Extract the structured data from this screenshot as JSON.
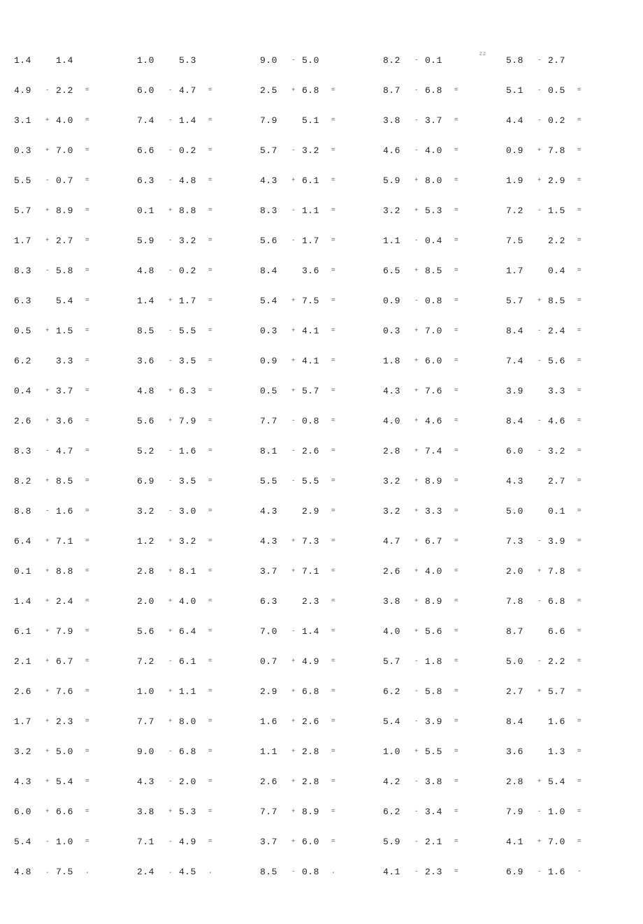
{
  "rows": [
    [
      {
        "a": "1.4",
        "op": "",
        "b": "1.4",
        "eq": ""
      },
      {
        "a": "1.0",
        "op": "",
        "b": "5.3",
        "eq": ""
      },
      {
        "a": "9.0",
        "op": "-",
        "b": "5.0",
        "eq": ""
      },
      {
        "a": "8.2",
        "op": "-",
        "b": "0.1",
        "eq": "",
        "sup": "zz"
      },
      {
        "a": "5.8",
        "op": "-",
        "b": "2.7",
        "eq": ""
      }
    ],
    [
      {
        "a": "4.9",
        "op": "-",
        "b": "2.2",
        "eq": "="
      },
      {
        "a": "6.0",
        "op": "-",
        "b": "4.7",
        "eq": "="
      },
      {
        "a": "2.5",
        "op": "+",
        "b": "6.8",
        "eq": "="
      },
      {
        "a": "8.7",
        "op": "-",
        "b": "6.8",
        "eq": "="
      },
      {
        "a": "5.1",
        "op": "-",
        "b": "0.5",
        "eq": "="
      }
    ],
    [
      {
        "a": "3.1",
        "op": "+",
        "b": "4.0",
        "eq": "="
      },
      {
        "a": "7.4",
        "op": "-",
        "b": "1.4",
        "eq": "="
      },
      {
        "a": "7.9",
        "op": "",
        "b": "5.1",
        "eq": "="
      },
      {
        "a": "3.8",
        "op": "-",
        "b": "3.7",
        "eq": "="
      },
      {
        "a": "4.4",
        "op": "-",
        "b": "0.2",
        "eq": "="
      }
    ],
    [
      {
        "a": "0.3",
        "op": "+",
        "b": "7.0",
        "eq": "="
      },
      {
        "a": "6.6",
        "op": "-",
        "b": "0.2",
        "eq": "="
      },
      {
        "a": "5.7",
        "op": "-",
        "b": "3.2",
        "eq": "="
      },
      {
        "a": "4.6",
        "op": "-",
        "b": "4.0",
        "eq": "="
      },
      {
        "a": "0.9",
        "op": "+",
        "b": "7.8",
        "eq": "="
      }
    ],
    [
      {
        "a": "5.5",
        "op": "-",
        "b": "0.7",
        "eq": "="
      },
      {
        "a": "6.3",
        "op": "-",
        "b": "4.8",
        "eq": "="
      },
      {
        "a": "4.3",
        "op": "+",
        "b": "6.1",
        "eq": "="
      },
      {
        "a": "5.9",
        "op": "+",
        "b": "8.0",
        "eq": "="
      },
      {
        "a": "1.9",
        "op": "+",
        "b": "2.9",
        "eq": "="
      }
    ],
    [
      {
        "a": "5.7",
        "op": "+",
        "b": "8.9",
        "eq": "="
      },
      {
        "a": "0.1",
        "op": "+",
        "b": "8.8",
        "eq": "="
      },
      {
        "a": "8.3",
        "op": "-",
        "b": "1.1",
        "eq": "="
      },
      {
        "a": "3.2",
        "op": "+",
        "b": "5.3",
        "eq": "="
      },
      {
        "a": "7.2",
        "op": "-",
        "b": "1.5",
        "eq": "="
      }
    ],
    [
      {
        "a": "1.7",
        "op": "+",
        "b": "2.7",
        "eq": "="
      },
      {
        "a": "5.9",
        "op": "-",
        "b": "3.2",
        "eq": "="
      },
      {
        "a": "5.6",
        "op": "-",
        "b": "1.7",
        "eq": "="
      },
      {
        "a": "1.1",
        "op": "-",
        "b": "0.4",
        "eq": "="
      },
      {
        "a": "7.5",
        "op": "",
        "b": "2.2",
        "eq": "="
      }
    ],
    [
      {
        "a": "8.3",
        "op": "-",
        "b": "5.8",
        "eq": "="
      },
      {
        "a": "4.8",
        "op": "-",
        "b": "0.2",
        "eq": "="
      },
      {
        "a": "8.4",
        "op": "",
        "b": "3.6",
        "eq": "="
      },
      {
        "a": "6.5",
        "op": "+",
        "b": "8.5",
        "eq": "="
      },
      {
        "a": "1.7",
        "op": "",
        "b": "0.4",
        "eq": "="
      }
    ],
    [
      {
        "a": "6.3",
        "op": "",
        "b": "5.4",
        "eq": "="
      },
      {
        "a": "1.4",
        "op": "+",
        "b": "1.7",
        "eq": "="
      },
      {
        "a": "5.4",
        "op": "+",
        "b": "7.5",
        "eq": "="
      },
      {
        "a": "0.9",
        "op": "-",
        "b": "0.8",
        "eq": "="
      },
      {
        "a": "5.7",
        "op": "+",
        "b": "8.5",
        "eq": "="
      }
    ],
    [
      {
        "a": "0.5",
        "op": "+",
        "b": "1.5",
        "eq": "="
      },
      {
        "a": "8.5",
        "op": "-",
        "b": "5.5",
        "eq": "="
      },
      {
        "a": "0.3",
        "op": "+",
        "b": "4.1",
        "eq": "="
      },
      {
        "a": "0.3",
        "op": "+",
        "b": "7.0",
        "eq": "="
      },
      {
        "a": "8.4",
        "op": "-",
        "b": "2.4",
        "eq": "="
      }
    ],
    [
      {
        "a": "6.2",
        "op": "",
        "b": "3.3",
        "eq": "="
      },
      {
        "a": "3.6",
        "op": "-",
        "b": "3.5",
        "eq": "="
      },
      {
        "a": "0.9",
        "op": "+",
        "b": "4.1",
        "eq": "="
      },
      {
        "a": "1.8",
        "op": "+",
        "b": "6.0",
        "eq": "="
      },
      {
        "a": "7.4",
        "op": "-",
        "b": "5.6",
        "eq": "="
      }
    ],
    [
      {
        "a": "0.4",
        "op": "+",
        "b": "3.7",
        "eq": "="
      },
      {
        "a": "4.8",
        "op": "+",
        "b": "6.3",
        "eq": "="
      },
      {
        "a": "0.5",
        "op": "+",
        "b": "5.7",
        "eq": "="
      },
      {
        "a": "4.3",
        "op": "+",
        "b": "7.6",
        "eq": "="
      },
      {
        "a": "3.9",
        "op": "",
        "b": "3.3",
        "eq": "="
      }
    ],
    [
      {
        "a": "2.6",
        "op": "+",
        "b": "3.6",
        "eq": "="
      },
      {
        "a": "5.6",
        "op": "+",
        "b": "7.9",
        "eq": "="
      },
      {
        "a": "7.7",
        "op": "-",
        "b": "0.8",
        "eq": "="
      },
      {
        "a": "4.0",
        "op": "+",
        "b": "4.6",
        "eq": "="
      },
      {
        "a": "8.4",
        "op": "-",
        "b": "4.6",
        "eq": "="
      }
    ],
    [
      {
        "a": "8.3",
        "op": "-",
        "b": "4.7",
        "eq": "="
      },
      {
        "a": "5.2",
        "op": "-",
        "b": "1.6",
        "eq": "="
      },
      {
        "a": "8.1",
        "op": "-",
        "b": "2.6",
        "eq": "="
      },
      {
        "a": "2.8",
        "op": "+",
        "b": "7.4",
        "eq": "="
      },
      {
        "a": "6.0",
        "op": "-",
        "b": "3.2",
        "eq": "="
      }
    ],
    [
      {
        "a": "8.2",
        "op": "+",
        "b": "8.5",
        "eq": "="
      },
      {
        "a": "6.9",
        "op": "-",
        "b": "3.5",
        "eq": "="
      },
      {
        "a": "5.5",
        "op": "-",
        "b": "5.5",
        "eq": "="
      },
      {
        "a": "3.2",
        "op": "+",
        "b": "8.9",
        "eq": "="
      },
      {
        "a": "4.3",
        "op": "",
        "b": "2.7",
        "eq": "="
      }
    ],
    [
      {
        "a": "8.8",
        "op": "-",
        "b": "1.6",
        "eq": "="
      },
      {
        "a": "3.2",
        "op": "-",
        "b": "3.0",
        "eq": "="
      },
      {
        "a": "4.3",
        "op": "",
        "b": "2.9",
        "eq": "="
      },
      {
        "a": "3.2",
        "op": "+",
        "b": "3.3",
        "eq": "="
      },
      {
        "a": "5.0",
        "op": "",
        "b": "0.1",
        "eq": "="
      }
    ],
    [
      {
        "a": "6.4",
        "op": "+",
        "b": "7.1",
        "eq": "="
      },
      {
        "a": "1.2",
        "op": "+",
        "b": "3.2",
        "eq": "="
      },
      {
        "a": "4.3",
        "op": "+",
        "b": "7.3",
        "eq": "="
      },
      {
        "a": "4.7",
        "op": "+",
        "b": "6.7",
        "eq": "="
      },
      {
        "a": "7.3",
        "op": "-",
        "b": "3.9",
        "eq": "="
      }
    ],
    [
      {
        "a": "0.1",
        "op": "+",
        "b": "8.8",
        "eq": "="
      },
      {
        "a": "2.8",
        "op": "+",
        "b": "8.1",
        "eq": "="
      },
      {
        "a": "3.7",
        "op": "+",
        "b": "7.1",
        "eq": "="
      },
      {
        "a": "2.6",
        "op": "+",
        "b": "4.0",
        "eq": "="
      },
      {
        "a": "2.0",
        "op": "+",
        "b": "7.8",
        "eq": "="
      }
    ],
    [
      {
        "a": "1.4",
        "op": "+",
        "b": "2.4",
        "eq": "="
      },
      {
        "a": "2.0",
        "op": "+",
        "b": "4.0",
        "eq": "="
      },
      {
        "a": "6.3",
        "op": "",
        "b": "2.3",
        "eq": "="
      },
      {
        "a": "3.8",
        "op": "+",
        "b": "8.9",
        "eq": "="
      },
      {
        "a": "7.8",
        "op": "-",
        "b": "6.8",
        "eq": "="
      }
    ],
    [
      {
        "a": "6.1",
        "op": "+",
        "b": "7.9",
        "eq": "="
      },
      {
        "a": "5.6",
        "op": "+",
        "b": "6.4",
        "eq": "="
      },
      {
        "a": "7.0",
        "op": "-",
        "b": "1.4",
        "eq": "="
      },
      {
        "a": "4.0",
        "op": "+",
        "b": "5.6",
        "eq": "="
      },
      {
        "a": "8.7",
        "op": "",
        "b": "6.6",
        "eq": "="
      }
    ],
    [
      {
        "a": "2.1",
        "op": "+",
        "b": "6.7",
        "eq": "="
      },
      {
        "a": "7.2",
        "op": "-",
        "b": "6.1",
        "eq": "="
      },
      {
        "a": "0.7",
        "op": "+",
        "b": "4.9",
        "eq": "="
      },
      {
        "a": "5.7",
        "op": "-",
        "b": "1.8",
        "eq": "="
      },
      {
        "a": "5.0",
        "op": "-",
        "b": "2.2",
        "eq": "="
      }
    ],
    [
      {
        "a": "2.6",
        "op": "+",
        "b": "7.6",
        "eq": "="
      },
      {
        "a": "1.0",
        "op": "+",
        "b": "1.1",
        "eq": "="
      },
      {
        "a": "2.9",
        "op": "+",
        "b": "6.8",
        "eq": "="
      },
      {
        "a": "6.2",
        "op": "-",
        "b": "5.8",
        "eq": "="
      },
      {
        "a": "2.7",
        "op": "+",
        "b": "5.7",
        "eq": "="
      }
    ],
    [
      {
        "a": "1.7",
        "op": "+",
        "b": "2.3",
        "eq": "="
      },
      {
        "a": "7.7",
        "op": "+",
        "b": "8.0",
        "eq": "="
      },
      {
        "a": "1.6",
        "op": "+",
        "b": "2.6",
        "eq": "="
      },
      {
        "a": "5.4",
        "op": "-",
        "b": "3.9",
        "eq": "="
      },
      {
        "a": "8.4",
        "op": "",
        "b": "1.6",
        "eq": "="
      }
    ],
    [
      {
        "a": "3.2",
        "op": "+",
        "b": "5.0",
        "eq": "="
      },
      {
        "a": "9.0",
        "op": "-",
        "b": "6.8",
        "eq": "="
      },
      {
        "a": "1.1",
        "op": "+",
        "b": "2.8",
        "eq": "="
      },
      {
        "a": "1.0",
        "op": "+",
        "b": "5.5",
        "eq": "="
      },
      {
        "a": "3.6",
        "op": "",
        "b": "1.3",
        "eq": "="
      }
    ],
    [
      {
        "a": "4.3",
        "op": "+",
        "b": "5.4",
        "eq": "="
      },
      {
        "a": "4.3",
        "op": "-",
        "b": "2.0",
        "eq": "="
      },
      {
        "a": "2.6",
        "op": "+",
        "b": "2.8",
        "eq": "="
      },
      {
        "a": "4.2",
        "op": "-",
        "b": "3.8",
        "eq": "="
      },
      {
        "a": "2.8",
        "op": "+",
        "b": "5.4",
        "eq": "="
      }
    ],
    [
      {
        "a": "6.0",
        "op": "+",
        "b": "6.6",
        "eq": "="
      },
      {
        "a": "3.8",
        "op": "+",
        "b": "5.3",
        "eq": "="
      },
      {
        "a": "7.7",
        "op": "+",
        "b": "8.9",
        "eq": "="
      },
      {
        "a": "6.2",
        "op": "-",
        "b": "3.4",
        "eq": "="
      },
      {
        "a": "7.9",
        "op": "-",
        "b": "1.0",
        "eq": "="
      }
    ],
    [
      {
        "a": "5.4",
        "op": "-",
        "b": "1.0",
        "eq": "="
      },
      {
        "a": "7.1",
        "op": "-",
        "b": "4.9",
        "eq": "="
      },
      {
        "a": "3.7",
        "op": "+",
        "b": "6.0",
        "eq": "="
      },
      {
        "a": "5.9",
        "op": "-",
        "b": "2.1",
        "eq": "="
      },
      {
        "a": "4.1",
        "op": "+",
        "b": "7.0",
        "eq": "="
      }
    ],
    [
      {
        "a": "4.8",
        "op": ".",
        "b": "7.5",
        "eq": "."
      },
      {
        "a": "2.4",
        "op": ".",
        "b": "4.5",
        "eq": "."
      },
      {
        "a": "8.5",
        "op": "-",
        "b": "0.8",
        "eq": "."
      },
      {
        "a": "4.1",
        "op": "-",
        "b": "2.3",
        "eq": "="
      },
      {
        "a": "6.9",
        "op": "-",
        "b": "1.6",
        "eq": "-"
      }
    ]
  ]
}
